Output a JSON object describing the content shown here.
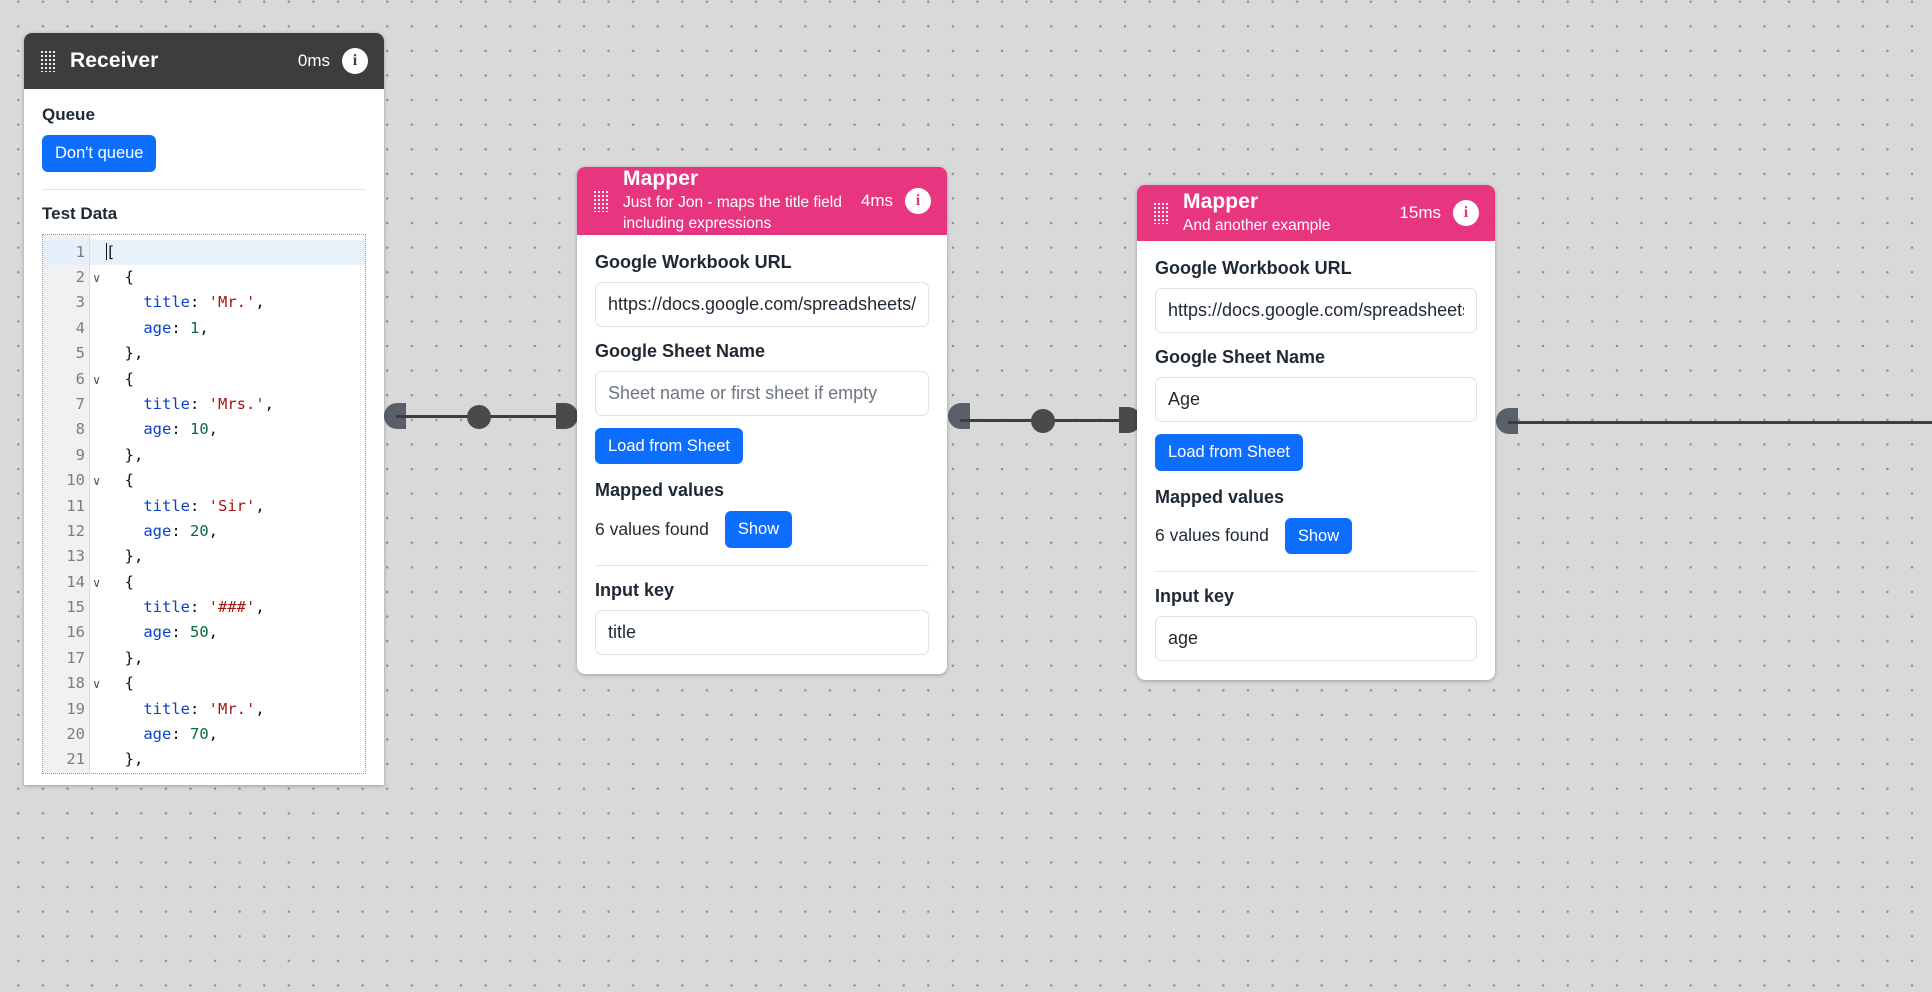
{
  "canvas": {
    "background_color": "#d9d9d9",
    "dot_color": "#8e8e8e"
  },
  "nodes": {
    "receiver": {
      "title": "Receiver",
      "time": "0ms",
      "info_icon": "i",
      "header_color": "#3d3d3d",
      "queue_label": "Queue",
      "queue_button": "Don't queue",
      "test_data_label": "Test Data",
      "code_lines": [
        {
          "num": "1",
          "fold": true,
          "active": true,
          "indent": 0,
          "tokens": [
            {
              "t": "caret"
            },
            {
              "t": "pun",
              "v": "["
            }
          ]
        },
        {
          "num": "2",
          "fold": true,
          "active": false,
          "indent": 1,
          "tokens": [
            {
              "t": "pun",
              "v": "{"
            }
          ]
        },
        {
          "num": "3",
          "fold": false,
          "active": false,
          "indent": 2,
          "tokens": [
            {
              "t": "key",
              "v": "title"
            },
            {
              "t": "pun",
              "v": ": "
            },
            {
              "t": "str",
              "v": "'Mr.'"
            },
            {
              "t": "pun",
              "v": ","
            }
          ]
        },
        {
          "num": "4",
          "fold": false,
          "active": false,
          "indent": 2,
          "tokens": [
            {
              "t": "key",
              "v": "age"
            },
            {
              "t": "pun",
              "v": ": "
            },
            {
              "t": "num",
              "v": "1"
            },
            {
              "t": "pun",
              "v": ","
            }
          ]
        },
        {
          "num": "5",
          "fold": false,
          "active": false,
          "indent": 1,
          "tokens": [
            {
              "t": "pun",
              "v": "},"
            }
          ]
        },
        {
          "num": "6",
          "fold": true,
          "active": false,
          "indent": 1,
          "tokens": [
            {
              "t": "pun",
              "v": "{"
            }
          ]
        },
        {
          "num": "7",
          "fold": false,
          "active": false,
          "indent": 2,
          "tokens": [
            {
              "t": "key",
              "v": "title"
            },
            {
              "t": "pun",
              "v": ": "
            },
            {
              "t": "str",
              "v": "'Mrs.'"
            },
            {
              "t": "pun",
              "v": ","
            }
          ]
        },
        {
          "num": "8",
          "fold": false,
          "active": false,
          "indent": 2,
          "tokens": [
            {
              "t": "key",
              "v": "age"
            },
            {
              "t": "pun",
              "v": ": "
            },
            {
              "t": "num",
              "v": "10"
            },
            {
              "t": "pun",
              "v": ","
            }
          ]
        },
        {
          "num": "9",
          "fold": false,
          "active": false,
          "indent": 1,
          "tokens": [
            {
              "t": "pun",
              "v": "},"
            }
          ]
        },
        {
          "num": "10",
          "fold": true,
          "active": false,
          "indent": 1,
          "tokens": [
            {
              "t": "pun",
              "v": "{"
            }
          ]
        },
        {
          "num": "11",
          "fold": false,
          "active": false,
          "indent": 2,
          "tokens": [
            {
              "t": "key",
              "v": "title"
            },
            {
              "t": "pun",
              "v": ": "
            },
            {
              "t": "str",
              "v": "'Sir'"
            },
            {
              "t": "pun",
              "v": ","
            }
          ]
        },
        {
          "num": "12",
          "fold": false,
          "active": false,
          "indent": 2,
          "tokens": [
            {
              "t": "key",
              "v": "age"
            },
            {
              "t": "pun",
              "v": ": "
            },
            {
              "t": "num",
              "v": "20"
            },
            {
              "t": "pun",
              "v": ","
            }
          ]
        },
        {
          "num": "13",
          "fold": false,
          "active": false,
          "indent": 1,
          "tokens": [
            {
              "t": "pun",
              "v": "},"
            }
          ]
        },
        {
          "num": "14",
          "fold": true,
          "active": false,
          "indent": 1,
          "tokens": [
            {
              "t": "pun",
              "v": "{"
            }
          ]
        },
        {
          "num": "15",
          "fold": false,
          "active": false,
          "indent": 2,
          "tokens": [
            {
              "t": "key",
              "v": "title"
            },
            {
              "t": "pun",
              "v": ": "
            },
            {
              "t": "str",
              "v": "'###'"
            },
            {
              "t": "pun",
              "v": ","
            }
          ]
        },
        {
          "num": "16",
          "fold": false,
          "active": false,
          "indent": 2,
          "tokens": [
            {
              "t": "key",
              "v": "age"
            },
            {
              "t": "pun",
              "v": ": "
            },
            {
              "t": "num",
              "v": "50"
            },
            {
              "t": "pun",
              "v": ","
            }
          ]
        },
        {
          "num": "17",
          "fold": false,
          "active": false,
          "indent": 1,
          "tokens": [
            {
              "t": "pun",
              "v": "},"
            }
          ]
        },
        {
          "num": "18",
          "fold": true,
          "active": false,
          "indent": 1,
          "tokens": [
            {
              "t": "pun",
              "v": "{"
            }
          ]
        },
        {
          "num": "19",
          "fold": false,
          "active": false,
          "indent": 2,
          "tokens": [
            {
              "t": "key",
              "v": "title"
            },
            {
              "t": "pun",
              "v": ": "
            },
            {
              "t": "str",
              "v": "'Mr.'"
            },
            {
              "t": "pun",
              "v": ","
            }
          ]
        },
        {
          "num": "20",
          "fold": false,
          "active": false,
          "indent": 2,
          "tokens": [
            {
              "t": "key",
              "v": "age"
            },
            {
              "t": "pun",
              "v": ": "
            },
            {
              "t": "num",
              "v": "70"
            },
            {
              "t": "pun",
              "v": ","
            }
          ]
        },
        {
          "num": "21",
          "fold": false,
          "active": false,
          "indent": 1,
          "tokens": [
            {
              "t": "pun",
              "v": "},"
            }
          ]
        }
      ]
    },
    "mapper1": {
      "title": "Mapper",
      "subtitle": "Just for Jon - maps the title field including expressions",
      "time": "4ms",
      "info_icon": "i",
      "header_color": "#e8357f",
      "workbook_label": "Google Workbook URL",
      "workbook_value": "https://docs.google.com/spreadsheets/d/",
      "sheet_label": "Google Sheet Name",
      "sheet_value": "",
      "sheet_placeholder": "Sheet name or first sheet if empty",
      "load_button": "Load from Sheet",
      "mapped_label": "Mapped values",
      "values_found": "6 values found",
      "show_button": "Show",
      "input_key_label": "Input key",
      "input_key_value": "title"
    },
    "mapper2": {
      "title": "Mapper",
      "subtitle": "And another example",
      "time": "15ms",
      "info_icon": "i",
      "header_color": "#e8357f",
      "workbook_label": "Google Workbook URL",
      "workbook_value": "https://docs.google.com/spreadsheets",
      "sheet_label": "Google Sheet Name",
      "sheet_value": "Age",
      "sheet_placeholder": "Sheet name or first sheet if empty",
      "load_button": "Load from Sheet",
      "mapped_label": "Mapped values",
      "values_found": "6 values found",
      "show_button": "Show",
      "input_key_label": "Input key",
      "input_key_value": "age"
    }
  }
}
